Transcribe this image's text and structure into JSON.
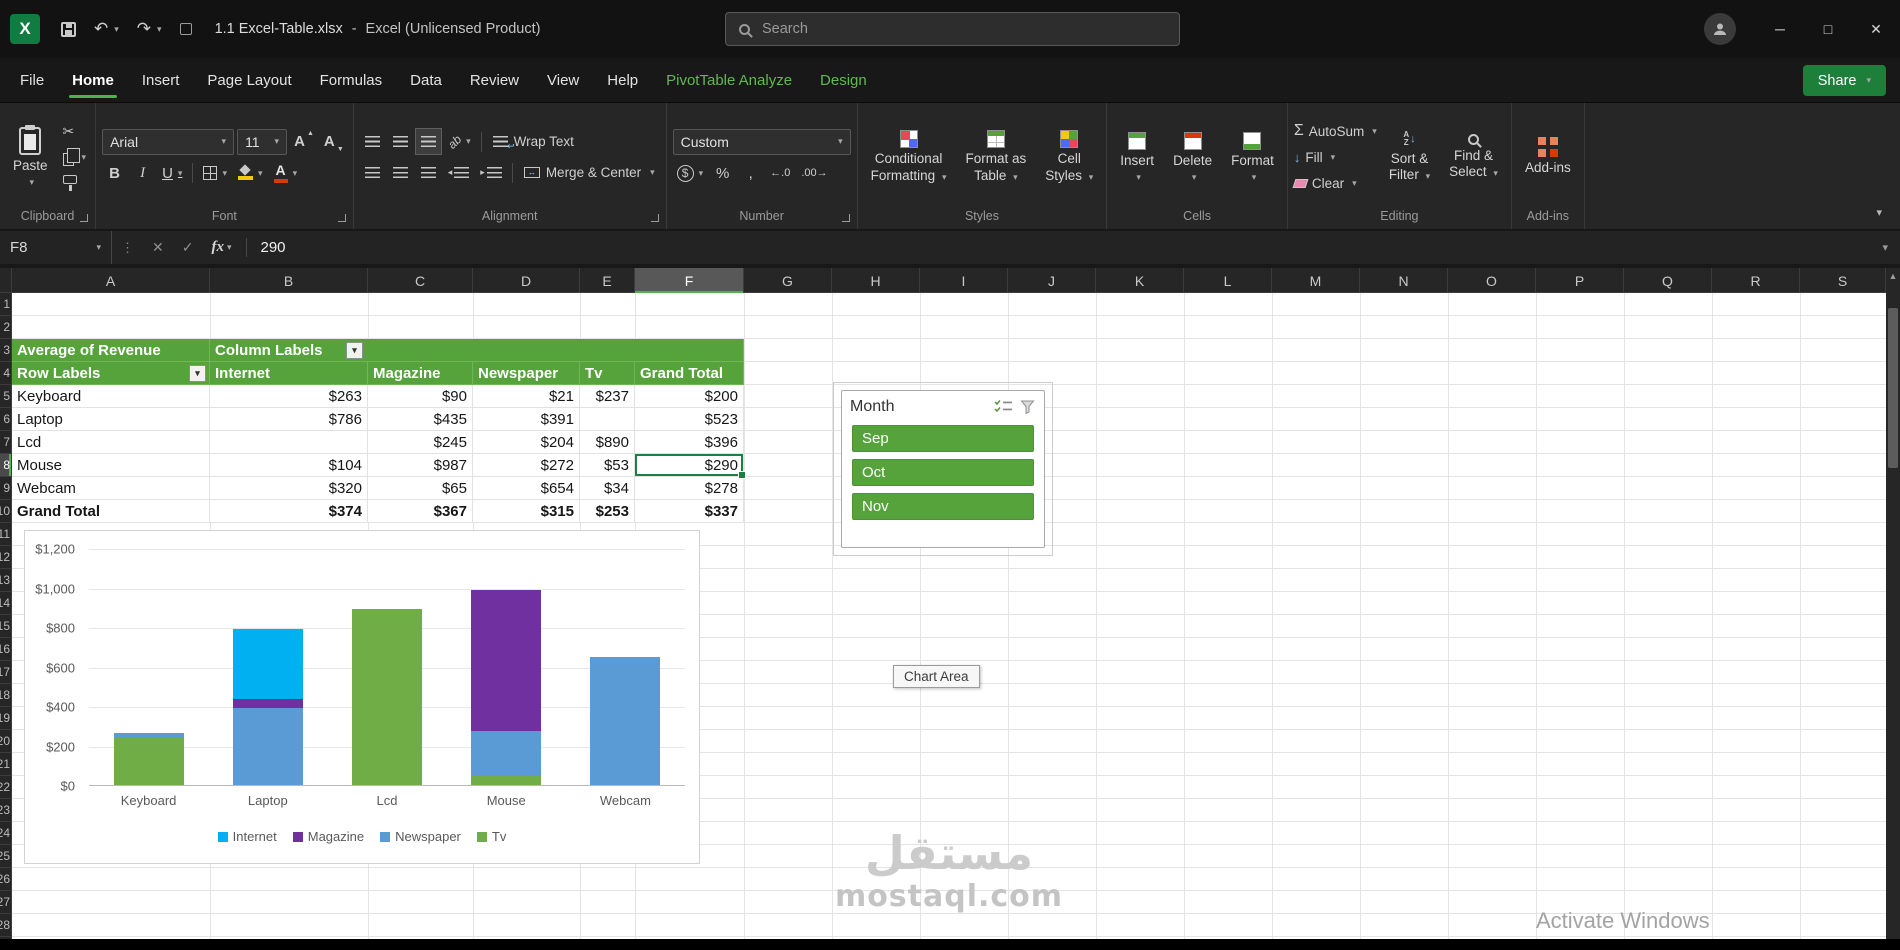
{
  "title_bar": {
    "document_title": "1.1 Excel-Table.xlsx",
    "separator": "-",
    "app_name": "Excel (Unlicensed Product)",
    "search_placeholder": "Search"
  },
  "ribbon_tabs": {
    "items": [
      "File",
      "Home",
      "Insert",
      "Page Layout",
      "Formulas",
      "Data",
      "Review",
      "View",
      "Help",
      "PivotTable Analyze",
      "Design"
    ],
    "active": "Home",
    "contextual": [
      "PivotTable Analyze",
      "Design"
    ],
    "share_label": "Share"
  },
  "ribbon": {
    "clipboard": {
      "paste": "Paste",
      "label": "Clipboard"
    },
    "font": {
      "family": "Arial",
      "size": "11",
      "bold": "B",
      "italic": "I",
      "underline": "U",
      "label": "Font"
    },
    "alignment": {
      "wrap_text": "Wrap Text",
      "merge_center": "Merge & Center",
      "label": "Alignment"
    },
    "number": {
      "format": "Custom",
      "label": "Number"
    },
    "styles": {
      "conditional_line1": "Conditional",
      "conditional_line2": "Formatting",
      "format_table_line1": "Format as",
      "format_table_line2": "Table",
      "cell_styles_line1": "Cell",
      "cell_styles_line2": "Styles",
      "label": "Styles"
    },
    "cells": {
      "insert": "Insert",
      "delete": "Delete",
      "format": "Format",
      "label": "Cells"
    },
    "editing": {
      "autosum": "AutoSum",
      "fill": "Fill",
      "clear": "Clear",
      "sort_line1": "Sort &",
      "sort_line2": "Filter",
      "find_line1": "Find &",
      "find_line2": "Select",
      "label": "Editing"
    },
    "addins": {
      "button": "Add-ins",
      "label": "Add-ins"
    }
  },
  "formula_bar": {
    "name_box": "F8",
    "fx": "fx",
    "value": "290"
  },
  "grid": {
    "columns": [
      "A",
      "B",
      "C",
      "D",
      "E",
      "F",
      "G",
      "H",
      "I",
      "J",
      "K",
      "L",
      "M",
      "N",
      "O",
      "P",
      "Q",
      "R",
      "S"
    ],
    "selected_column": "F",
    "selected_row": 8,
    "visible_rows": 28,
    "selected_cell": "F8"
  },
  "pivot_table": {
    "title_cell": "Average of Revenue",
    "column_labels_cell": "Column Labels",
    "row_labels_cell": "Row Labels",
    "column_headers": [
      "Internet",
      "Magazine",
      "Newspaper",
      "Tv",
      "Grand Total"
    ],
    "rows": [
      {
        "label": "Keyboard",
        "values": [
          "$263",
          "$90",
          "$21",
          "$237",
          "$200"
        ]
      },
      {
        "label": "Laptop",
        "values": [
          "$786",
          "$435",
          "$391",
          "",
          "$523"
        ]
      },
      {
        "label": "Lcd",
        "values": [
          "",
          "$245",
          "$204",
          "$890",
          "$396"
        ]
      },
      {
        "label": "Mouse",
        "values": [
          "$104",
          "$987",
          "$272",
          "$53",
          "$290"
        ]
      },
      {
        "label": "Webcam",
        "values": [
          "$320",
          "$65",
          "$654",
          "$34",
          "$278"
        ]
      }
    ],
    "grand_total_row": {
      "label": "Grand Total",
      "values": [
        "$374",
        "$367",
        "$315",
        "$253",
        "$337"
      ]
    },
    "selected": {
      "row_label": "Mouse",
      "column": "Grand Total",
      "value": "$290"
    }
  },
  "slicer": {
    "title": "Month",
    "items": [
      "Sep",
      "Oct",
      "Nov"
    ]
  },
  "chart_data": {
    "type": "bar",
    "stacked": true,
    "categories": [
      "Keyboard",
      "Laptop",
      "Lcd",
      "Mouse",
      "Webcam"
    ],
    "series": [
      {
        "name": "Internet",
        "color": "#00b0f0",
        "values": [
          0,
          355,
          0,
          0,
          0
        ]
      },
      {
        "name": "Magazine",
        "color": "#7030a0",
        "values": [
          0,
          45,
          0,
          710,
          0
        ]
      },
      {
        "name": "Newspaper",
        "color": "#5b9bd5",
        "values": [
          25,
          390,
          0,
          225,
          650
        ]
      },
      {
        "name": "Tv",
        "color": "#70ad47",
        "values": [
          240,
          0,
          890,
          50,
          0
        ]
      }
    ],
    "stack_order": [
      "Tv",
      "Newspaper",
      "Magazine",
      "Internet"
    ],
    "ylim": [
      0,
      1200
    ],
    "ytick_labels": [
      "$0",
      "$200",
      "$400",
      "$600",
      "$800",
      "$1,000",
      "$1,200"
    ],
    "grid": true,
    "legend": [
      "Internet",
      "Magazine",
      "Newspaper",
      "Tv"
    ],
    "legend_position": "bottom"
  },
  "chart_tooltip": "Chart Area",
  "watermark": {
    "line1": "مستقل",
    "line2": "mostaql.com"
  },
  "activate_windows": "Activate Windows"
}
